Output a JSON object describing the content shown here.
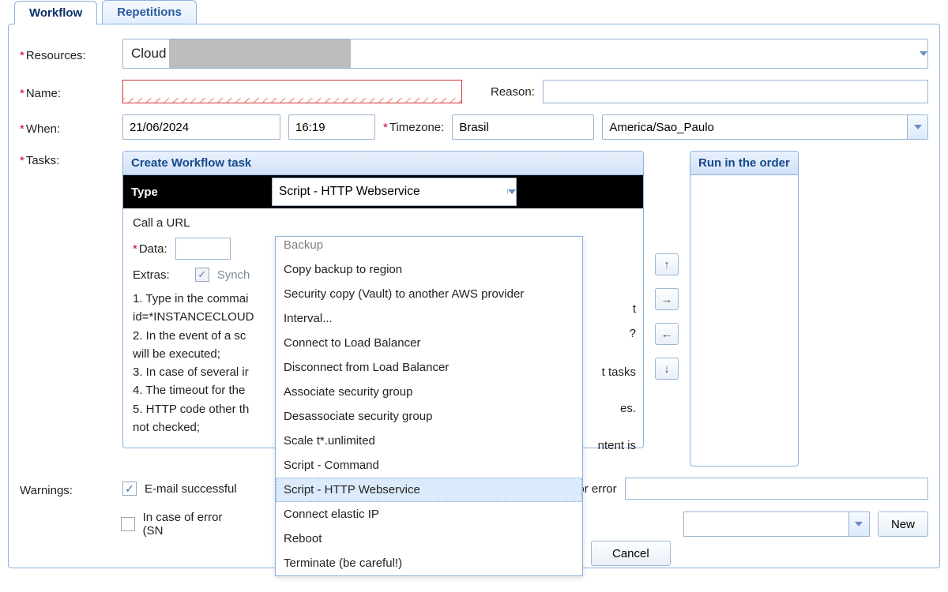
{
  "tabs": {
    "workflow": "Workflow",
    "repetitions": "Repetitions"
  },
  "labels": {
    "resources": "Resources:",
    "name": "Name:",
    "reason": "Reason:",
    "when": "When:",
    "timezone": "Timezone:",
    "tasks": "Tasks:",
    "warnings": "Warnings:"
  },
  "resources": {
    "value": "Cloud"
  },
  "name": {
    "value": ""
  },
  "reason": {
    "value": ""
  },
  "when": {
    "date": "21/06/2024",
    "time": "16:19"
  },
  "timezone": {
    "region": "Brasil",
    "zone": "America/Sao_Paulo"
  },
  "panels": {
    "create_task": "Create Workflow task",
    "run_order": "Run in the order"
  },
  "type": {
    "label": "Type",
    "selected": "Script - HTTP Webservice",
    "options_top_cut": "Backup",
    "options": [
      "Copy backup to region",
      "Security copy (Vault) to another AWS provider",
      "Interval...",
      "Connect to Load Balancer",
      "Disconnect from Load Balancer",
      "Associate security group",
      "Desassociate security group",
      "Scale t*.unlimited",
      "Script - Command",
      "Script - HTTP Webservice",
      "Connect elastic IP",
      "Reboot",
      "Terminate (be careful!)"
    ],
    "highlighted_index": 9
  },
  "task_body": {
    "call_url": "Call a URL",
    "data_label": "Data:",
    "extras_label": "Extras:",
    "extras_sync": "Synch",
    "help_1": "1. Type in the commai",
    "help_1b": "id=*INSTANCECLOUD",
    "help_2": "2. In the event of a sc",
    "help_2b": "will be executed;",
    "help_3": "3. In case of several ir",
    "help_4": "4. The timeout for the",
    "help_5": "5. HTTP code other th",
    "help_5b": "not checked;",
    "behind_t": "t",
    "behind_q": "?",
    "behind_tasks": "t tasks",
    "behind_es": "es.",
    "behind_ntent": "ntent is"
  },
  "warnings": {
    "email_success": "E-mail successful",
    "mail_error": "hail for error",
    "error_snps": "In case of error (SN",
    "new_btn": "New"
  },
  "buttons": {
    "cancel": "Cancel",
    "new": "New"
  }
}
